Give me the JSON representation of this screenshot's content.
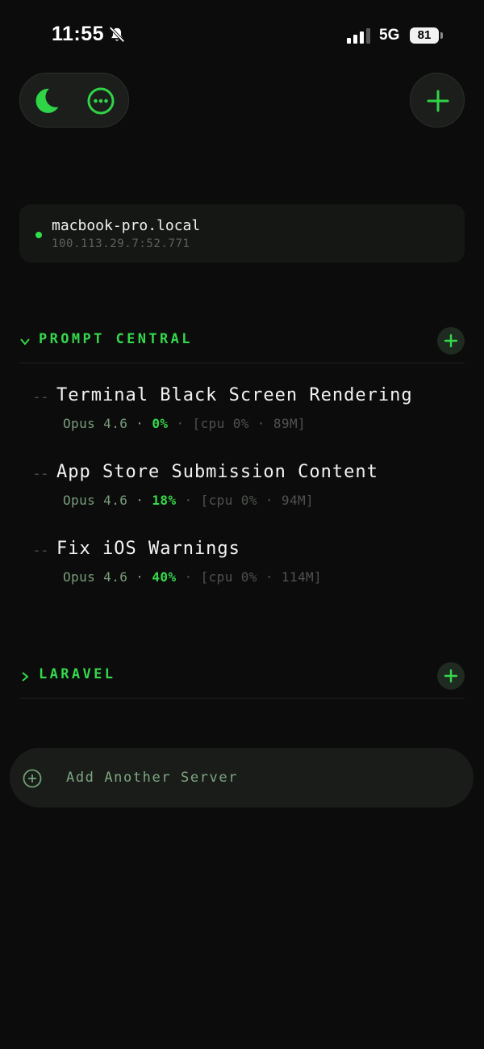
{
  "status_bar": {
    "time": "11:55",
    "network": "5G",
    "battery": "81"
  },
  "server": {
    "host": "macbook-pro.local",
    "address": "100.113.29.7:52.771",
    "status_color": "#2ee04a"
  },
  "groups": [
    {
      "title": "PROMPT CENTRAL",
      "expanded": true,
      "sessions": [
        {
          "dash": "--",
          "title": "Terminal Black Screen Rendering",
          "model": "Opus 4.6",
          "sep1": " · ",
          "pct": "0%",
          "sep2": " · ",
          "stats": "[cpu 0% · 89M]"
        },
        {
          "dash": "--",
          "title": "App Store Submission Content",
          "model": "Opus 4.6",
          "sep1": " · ",
          "pct": "18%",
          "sep2": " · ",
          "stats": "[cpu 0% · 94M]"
        },
        {
          "dash": "--",
          "title": "Fix iOS Warnings",
          "model": "Opus 4.6",
          "sep1": " · ",
          "pct": "40%",
          "sep2": " · ",
          "stats": "[cpu 0% · 114M]"
        }
      ]
    },
    {
      "title": "LARAVEL",
      "expanded": false,
      "sessions": []
    }
  ],
  "add_server": {
    "label": "Add Another Server"
  },
  "icons": {
    "theme": "moon-icon",
    "menu": "more-icon",
    "add": "plus-icon",
    "mute": "bell-slash-icon",
    "signal": "signal-icon",
    "add_server": "plus-circle-icon"
  },
  "colors": {
    "accent": "#35d84c",
    "background": "#0b0c0b",
    "card": "#151715",
    "muted_text": "#7a9c7c"
  }
}
